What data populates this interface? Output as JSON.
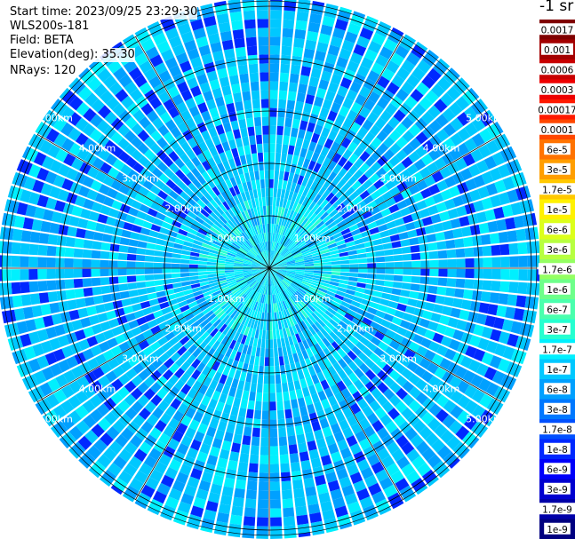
{
  "header": {
    "start_time": "Start time: 2023/09/25 23:29:30",
    "instrument": "WLS200s-181",
    "field": "Field: BETA",
    "elevation": "Elevation(deg): 35.30",
    "nrays": "NRays: 120"
  },
  "colorbar": {
    "unit": "-1 sr",
    "labels": [
      "0.0017",
      "0.001",
      "0.0006",
      "0.0003",
      "0.00017",
      "0.0001",
      "6e-5",
      "3e-5",
      "1.7e-5",
      "1e-5",
      "6e-6",
      "3e-6",
      "1.7e-6",
      "1e-6",
      "6e-7",
      "3e-7",
      "1.7e-7",
      "1e-7",
      "6e-8",
      "3e-8",
      "1.7e-8",
      "1e-8",
      "6e-9",
      "3e-9",
      "1.7e-9",
      "1e-9"
    ],
    "colors": [
      "#7f0000",
      "#a30000",
      "#c80000",
      "#ee0000",
      "#ff1a00",
      "#ff4700",
      "#ff7300",
      "#ff9e00",
      "#ffc800",
      "#fff100",
      "#dcff1a",
      "#b7ff40",
      "#94ff62",
      "#6dff8a",
      "#4affad",
      "#26ffd0",
      "#00f0fe",
      "#00c8ff",
      "#00a0ff",
      "#0078ff",
      "#0050ff",
      "#0028ff",
      "#0000fa",
      "#0000d0",
      "#0000a8",
      "#000080"
    ]
  },
  "chart_data": {
    "type": "heatmap",
    "projection": "polar-ppi",
    "field": "BETA",
    "elevation_deg": 35.3,
    "n_rays": 120,
    "range_rings_km": [
      1.0,
      2.0,
      3.0,
      4.0,
      5.0
    ],
    "range_ring_labels": [
      "1.00km",
      "2.00km",
      "3.00km",
      "4.00km",
      "5.00km"
    ],
    "max_range_km": 5.1,
    "spokes_deg": [
      0,
      30,
      60,
      90,
      120,
      150,
      180,
      210,
      240,
      270,
      300,
      330
    ],
    "value_pattern": {
      "dominant_near_center": "1.7e-7",
      "dominant_mid_range": "1e-7",
      "dominant_far_range": "1e-7",
      "sparse_low_values": "1e-8"
    }
  }
}
